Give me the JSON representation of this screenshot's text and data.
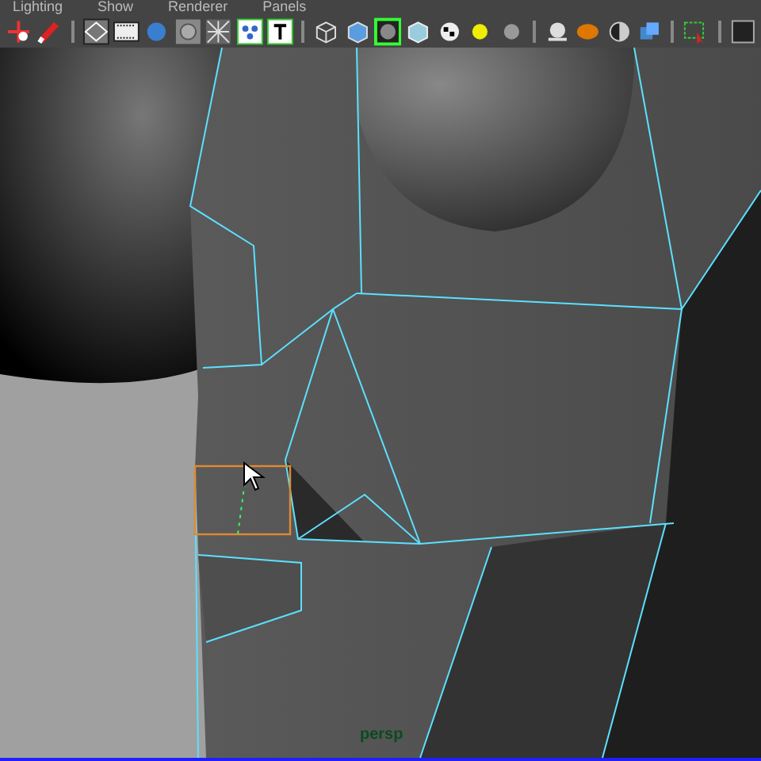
{
  "menu_bar": [
    "Lighting",
    "Show",
    "Renderer",
    "Panels"
  ],
  "viewport": {
    "camera": "persp"
  }
}
